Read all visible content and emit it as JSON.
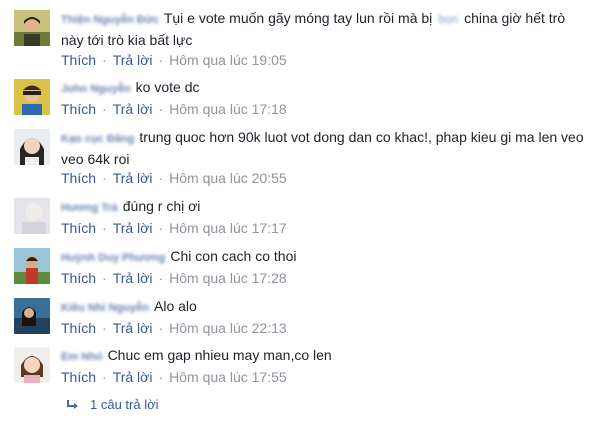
{
  "comments": [
    {
      "name": "Thiện Nguyễn Đức",
      "text_before": "Tụi e vote muốn gãy móng tay lun rồi mà bị",
      "blurred_word": "bọn",
      "text_after": "china giờ hết trò này tới trò kia bất lực",
      "like_label": "Thích",
      "reply_label": "Trả lời",
      "time": "Hôm qua lúc 19:05",
      "avatar_icon": "avatar-photo-icon"
    },
    {
      "name": "John Nguyễn",
      "text": "ko vote dc",
      "like_label": "Thích",
      "reply_label": "Trả lời",
      "time": "Hôm qua lúc 17:18",
      "avatar_icon": "avatar-photo-icon"
    },
    {
      "name": "Kạo cục Đăng",
      "text": "trung quoc hơn 90k luot vot dong dan co khac!, phap kieu gi ma len veo veo 64k roi",
      "like_label": "Thích",
      "reply_label": "Trả lời",
      "time": "Hôm qua lúc 20:55",
      "avatar_icon": "avatar-photo-icon"
    },
    {
      "name": "Hương Trà",
      "text": "đúng r chị ơi",
      "like_label": "Thích",
      "reply_label": "Trả lời",
      "time": "Hôm qua lúc 17:17",
      "avatar_icon": "avatar-photo-icon"
    },
    {
      "name": "Huỳnh Duy Phương",
      "text": "Chi con cach co thoi",
      "like_label": "Thích",
      "reply_label": "Trả lời",
      "time": "Hôm qua lúc 17:28",
      "avatar_icon": "avatar-photo-icon"
    },
    {
      "name": "Kiều Nhi Nguyễn",
      "text": "Alo alo",
      "like_label": "Thích",
      "reply_label": "Trả lời",
      "time": "Hôm qua lúc 22:13",
      "avatar_icon": "avatar-photo-icon"
    },
    {
      "name": "Em Nhỏ",
      "text": "Chuc em gap nhieu may man,co len",
      "like_label": "Thích",
      "reply_label": "Trả lời",
      "time": "Hôm qua lúc 17:55",
      "avatar_icon": "avatar-photo-icon"
    }
  ],
  "replies_link": {
    "label": "1 câu trả lời",
    "icon": "reply-arrow-icon"
  },
  "colors": {
    "link": "#365899",
    "text": "#1d2129",
    "meta": "#90949c"
  }
}
